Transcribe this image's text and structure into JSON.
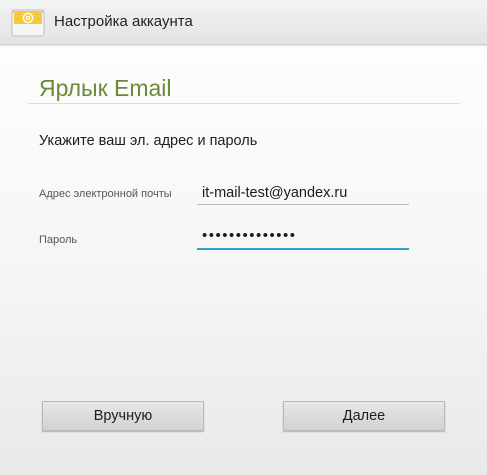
{
  "action_bar": {
    "title": "Настройка аккаунта",
    "icon": "email-app-icon"
  },
  "section": {
    "title": "Ярлык Email",
    "instruction": "Укажите ваш эл. адрес и пароль"
  },
  "form": {
    "email": {
      "label": "Адрес электронной почты",
      "value": "it-mail-test@yandex.ru"
    },
    "password": {
      "label": "Пароль",
      "masked_value": "••••••••••••••",
      "focused": true
    }
  },
  "buttons": {
    "manual_label": "Вручную",
    "next_label": "Далее"
  },
  "colors": {
    "accent_title": "#6a8a3a",
    "focus_underline": "#2ea5cf",
    "icon_envelope": "#f5c93a"
  }
}
